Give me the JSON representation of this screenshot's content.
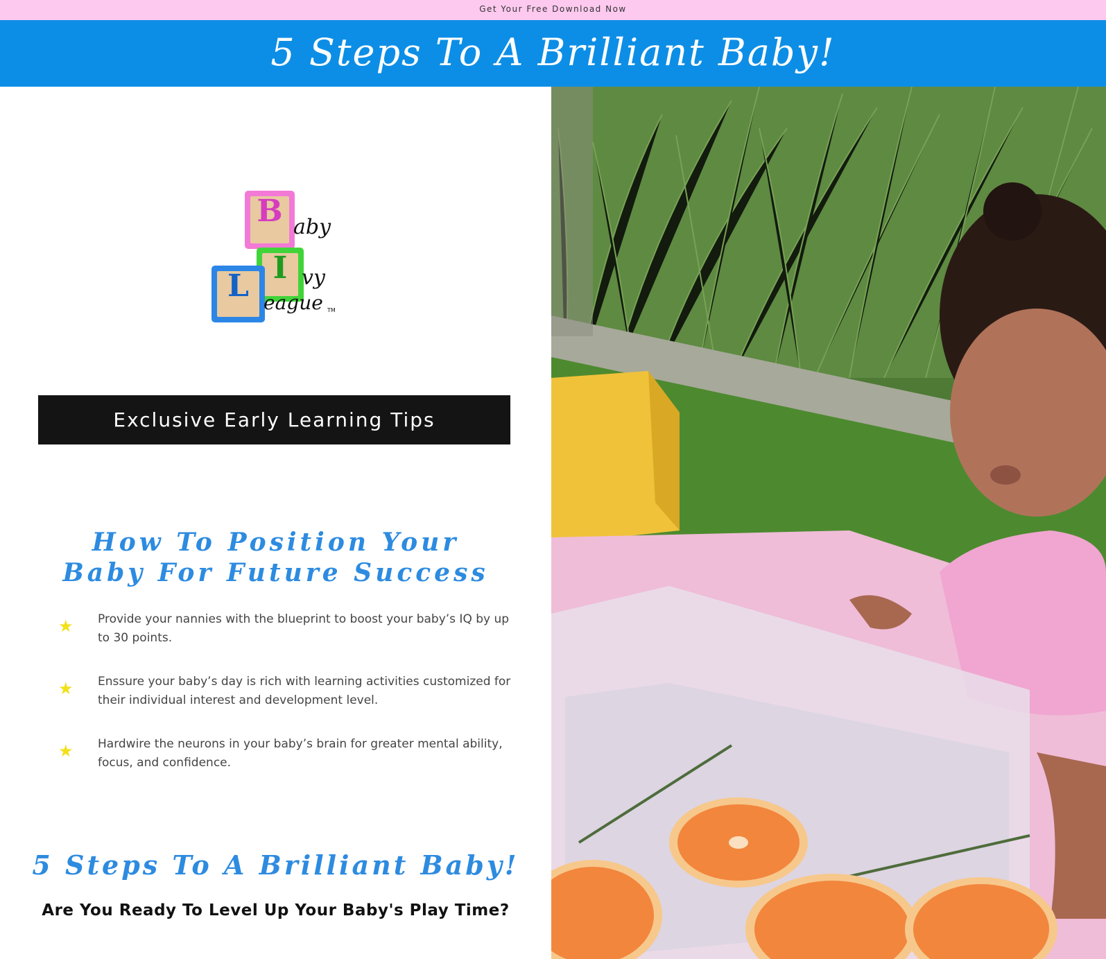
{
  "topbar": {
    "text": "Get Your Free Download Now"
  },
  "banner": {
    "title": "5 Steps To A Brilliant Baby!"
  },
  "logo": {
    "letters": [
      "B",
      "I",
      "L"
    ],
    "script": [
      "aby",
      "vy",
      "eague"
    ],
    "tm": "TM",
    "brand_colors": {
      "pink": "#f27ad6",
      "green": "#41d43a",
      "blue": "#2c86e6"
    }
  },
  "cta_bar": {
    "label": "Exclusive Early Learning Tips"
  },
  "headline": {
    "line1": "How To Position Your",
    "line2": "Baby For Future Success"
  },
  "bullets": [
    {
      "icon": "star-icon",
      "text": "Provide your nannies with the blueprint to boost your baby’s IQ by up to 30 points."
    },
    {
      "icon": "star-icon",
      "text": "Enssure your baby’s day is rich with learning activities customized for their individual interest and development level."
    },
    {
      "icon": "star-icon",
      "text": "Hardwire the neurons in your baby’s brain for greater mental ability, focus, and confidence."
    }
  ],
  "subhead": {
    "title": "5 Steps To A Brilliant Baby!"
  },
  "question": {
    "text": "Are You Ready To Level Up Your Baby's Play Time?"
  },
  "colors": {
    "topbar": "#fdc9ef",
    "banner": "#0d8ee6",
    "accent": "#2d8be0",
    "star": "#f3e01a"
  }
}
